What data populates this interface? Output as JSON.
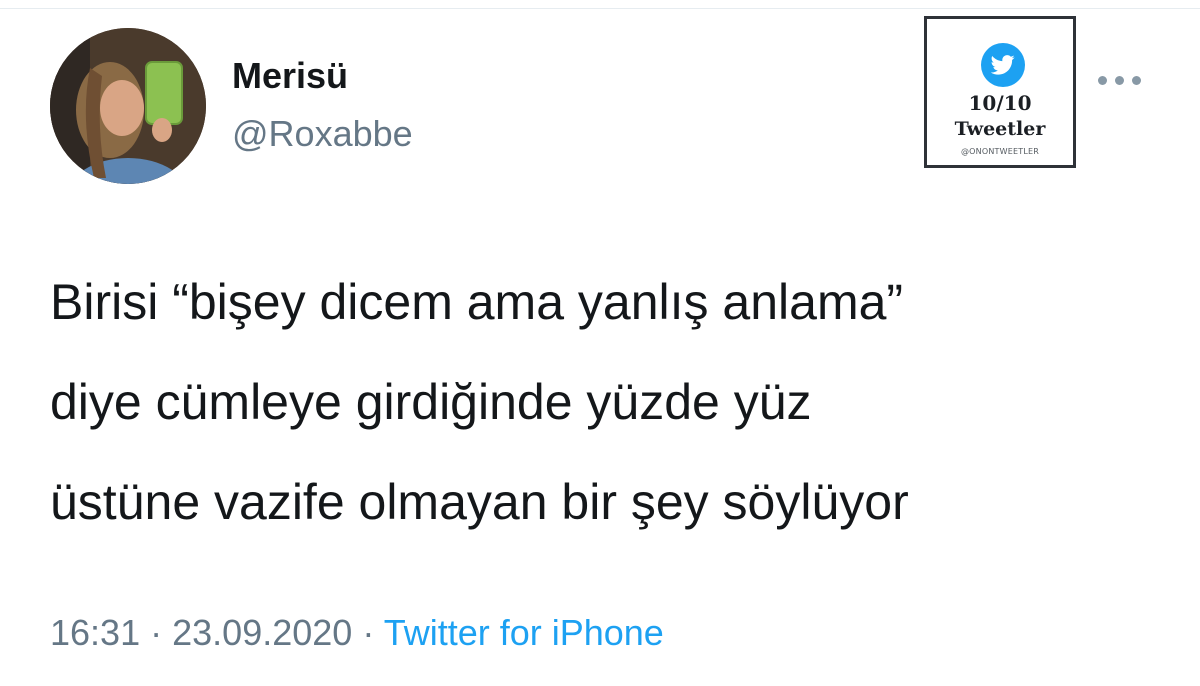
{
  "tweet": {
    "author": {
      "display_name": "Merisü",
      "handle": "@Roxabbe",
      "avatar_icon": "profile-photo"
    },
    "text_lines": [
      "Birisi “bişey dicem ama yanlış anlama”",
      "diye cümleye girdiğinde yüzde yüz",
      "üstüne vazife olmayan bir şey söylüyor"
    ],
    "time": "16:31",
    "separator": "·",
    "date": "23.09.2020",
    "source": "Twitter for iPhone",
    "more_icon": "more-horizontal-icon"
  },
  "watermark": {
    "icon": "twitter-bird-icon",
    "score": "10/10",
    "title": "Tweetler",
    "handle": "@ONONTWEETLER"
  },
  "colors": {
    "text_primary": "#14171a",
    "text_secondary": "#657786",
    "link_blue": "#1da1f2",
    "watermark_border": "#2e3238"
  }
}
